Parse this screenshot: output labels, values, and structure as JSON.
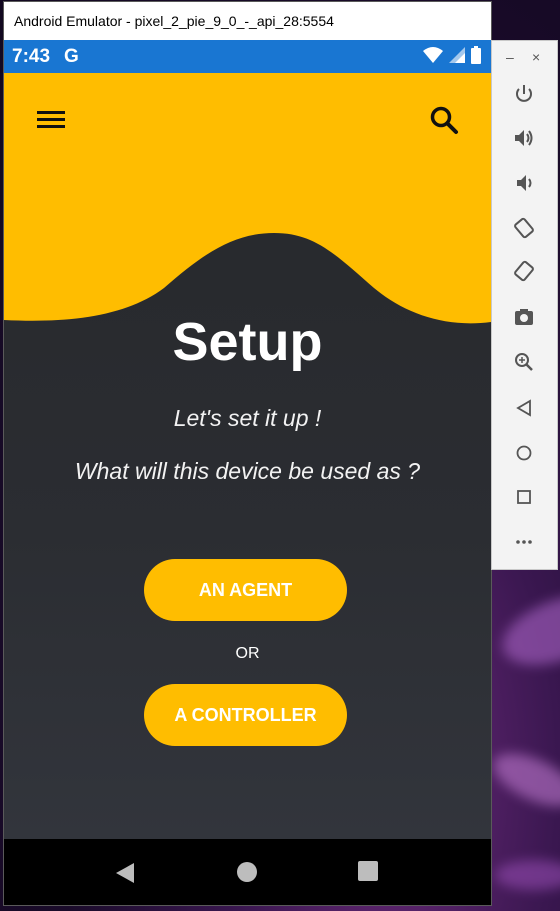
{
  "window": {
    "title": "Android Emulator - pixel_2_pie_9_0_-_api_28:5554"
  },
  "statusbar": {
    "time": "7:43",
    "g_label": "G"
  },
  "app": {
    "title": "Setup",
    "subtitle": "Let's set it up !",
    "question": "What will this device be used as ?",
    "agent_button": "AN AGENT",
    "or_label": "OR",
    "controller_button": "A CONTROLLER"
  },
  "colors": {
    "accent": "#ffbd00",
    "statusbar": "#1976d2",
    "background": "#2b2d31"
  },
  "toolbar": {
    "minimize": "–",
    "close": "×",
    "icons": [
      "power-icon",
      "volume-up-icon",
      "volume-down-icon",
      "rotate-left-icon",
      "rotate-right-icon",
      "camera-icon",
      "zoom-icon",
      "back-icon",
      "home-icon",
      "overview-icon",
      "more-icon"
    ]
  }
}
